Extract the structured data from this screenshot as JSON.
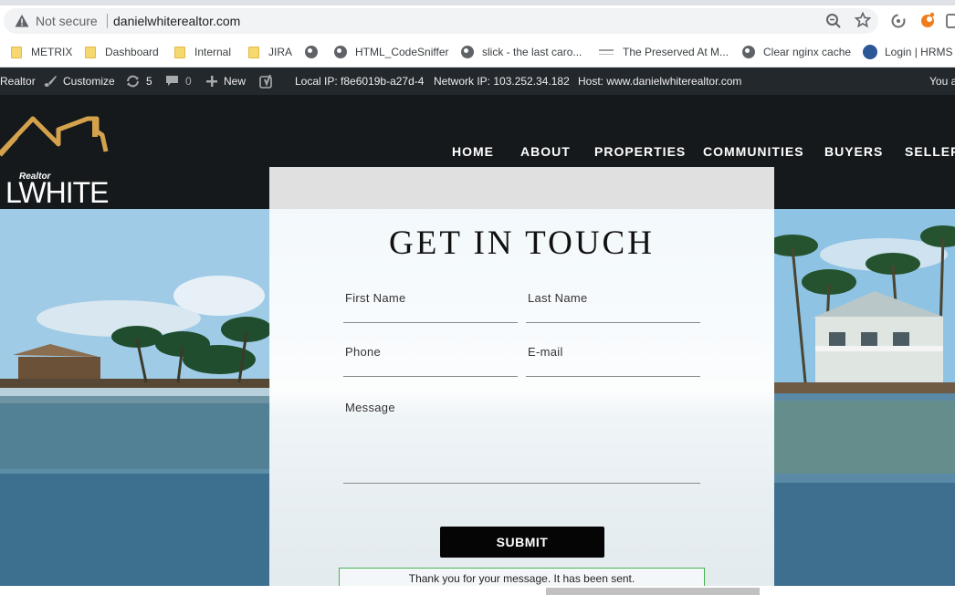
{
  "browser": {
    "security_label": "Not secure",
    "url": "danielwhiterealtor.com",
    "bookmarks": [
      {
        "label": "METRIX",
        "icon": "folder-icon"
      },
      {
        "label": "Dashboard",
        "icon": "folder-icon"
      },
      {
        "label": "Internal",
        "icon": "folder-icon"
      },
      {
        "label": "JIRA",
        "icon": "folder-icon"
      },
      {
        "label": "",
        "icon": "globe-icon"
      },
      {
        "label": "HTML_CodeSniffer",
        "icon": "globe-icon"
      },
      {
        "label": "slick - the last caro...",
        "icon": "globe-icon"
      },
      {
        "label": "The Preserved At M...",
        "icon": "site-favicon"
      },
      {
        "label": "Clear nginx cache",
        "icon": "globe-icon"
      },
      {
        "label": "Login | HRMS",
        "icon": "hrms-favicon"
      }
    ]
  },
  "adminbar": {
    "site": "Realtor",
    "customize": "Customize",
    "updates": "5",
    "comments": "0",
    "new": "New",
    "local_ip": "Local IP: f8e6019b-a27d-4",
    "network_ip": "Network IP: 103.252.34.182",
    "host": "Host: www.danielwhiterealtor.com",
    "account": "You a"
  },
  "header": {
    "logo_word": "LWHITE",
    "logo_realtor": "Realtor",
    "nav": [
      "HOME",
      "ABOUT",
      "PROPERTIES",
      "COMMUNITIES",
      "BUYERS",
      "SELLERS"
    ]
  },
  "form": {
    "title": "GET IN TOUCH",
    "first_name": "First Name",
    "last_name": "Last Name",
    "phone": "Phone",
    "email": "E-mail",
    "message": "Message",
    "submit": "SUBMIT",
    "success": "Thank you for your message. It has been sent."
  },
  "colors": {
    "header_bg": "#15191b",
    "adminbar_bg": "#23282d",
    "logo_gold": "#d4a24c",
    "success_border": "#46b450"
  }
}
